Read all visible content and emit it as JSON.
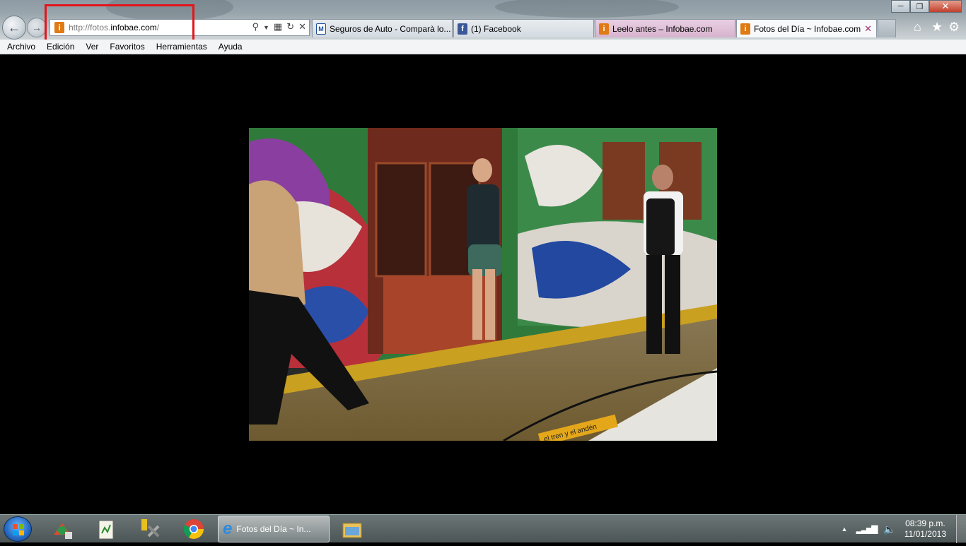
{
  "browser": {
    "address_url_prefix": "http://fotos.",
    "address_url_domain": "infobae.com",
    "address_url_suffix": "/"
  },
  "tabs": [
    {
      "label": "Seguros de Auto - Comparà lo...",
      "icon": "mt-icon"
    },
    {
      "label": "(1) Facebook",
      "icon": "facebook-icon"
    },
    {
      "label": "Leelo antes – Infobae.com",
      "icon": "infobae-icon"
    },
    {
      "label": "Fotos del Día ~ Infobae.com",
      "icon": "infobae-icon",
      "active": true
    }
  ],
  "menu": [
    "Archivo",
    "Edición",
    "Ver",
    "Favoritos",
    "Herramientas",
    "Ayuda"
  ],
  "platform_sign": "el tren y el andén",
  "taskbar": {
    "active_task_label": "Fotos del Día ~ In...",
    "time": "08:39 p.m.",
    "date": "11/01/2013"
  },
  "colors": {
    "highlight_box": "#e3151c",
    "infobae_orange": "#e07a14",
    "page_background": "#000000"
  }
}
